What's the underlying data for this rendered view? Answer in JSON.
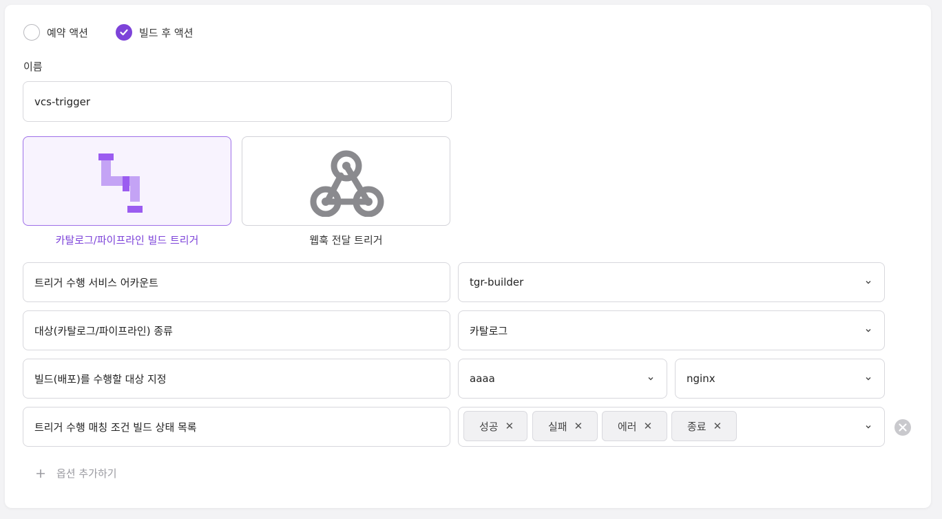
{
  "action_type": {
    "options": [
      {
        "label": "예약 액션",
        "checked": false
      },
      {
        "label": "빌드 후 액션",
        "checked": true
      }
    ]
  },
  "name_field": {
    "label": "이름",
    "value": "vcs-trigger"
  },
  "trigger_types": [
    {
      "label": "카탈로그/파이프라인 빌드 트리거",
      "icon": "pipeline-icon",
      "selected": true
    },
    {
      "label": "웹훅 전달 트리거",
      "icon": "webhook-icon",
      "selected": false
    }
  ],
  "rows": {
    "service_account": {
      "label": "트리거 수행 서비스 어카운트",
      "value": "tgr-builder"
    },
    "target_kind": {
      "label": "대상(카탈로그/파이프라인) 종류",
      "value": "카탈로그"
    },
    "build_target": {
      "label": "빌드(배포)를 수행할 대상 지정",
      "value1": "aaaa",
      "value2": "nginx"
    },
    "status_list": {
      "label": "트리거 수행 매칭 조건 빌드 상태 목록",
      "chips": [
        "성공",
        "실패",
        "에러",
        "종료"
      ]
    }
  },
  "add_option": {
    "label": "옵션 추가하기"
  },
  "colors": {
    "accent": "#7d43d9",
    "pipeline": "#c4a3f5",
    "pipeline_dark": "#9b5cf0",
    "webhook": "#8a8a8e"
  }
}
